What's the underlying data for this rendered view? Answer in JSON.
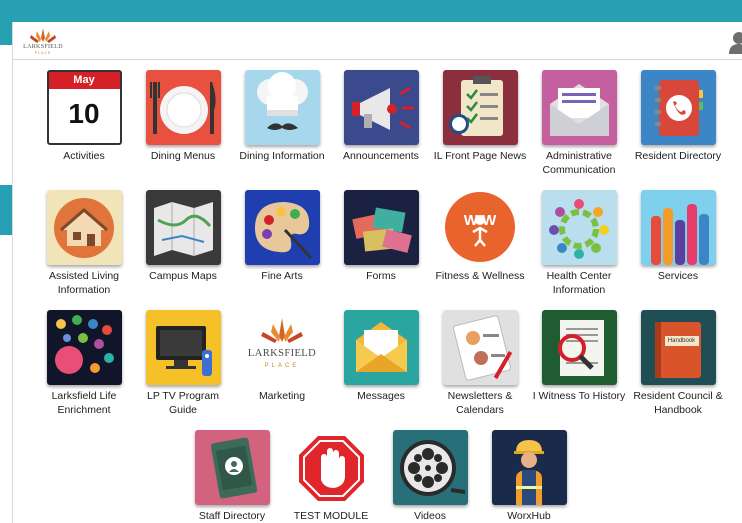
{
  "header": {
    "logo_text": "LARKSFIELD",
    "logo_sub": "PLACE"
  },
  "calendar": {
    "month": "May",
    "day": "10"
  },
  "marketing_logo": {
    "text": "LARKSFIELD",
    "sub": "PLACE"
  },
  "sticky_note": "Handbook",
  "tiles": [
    {
      "label": "Activities"
    },
    {
      "label": "Dining Menus"
    },
    {
      "label": "Dining Information"
    },
    {
      "label": "Announcements"
    },
    {
      "label": "IL Front Page News"
    },
    {
      "label": "Administrative Communication"
    },
    {
      "label": "Resident Directory"
    },
    {
      "label": "Assisted Living Information"
    },
    {
      "label": "Campus Maps"
    },
    {
      "label": "Fine Arts"
    },
    {
      "label": "Forms"
    },
    {
      "label": "Fitness & Wellness"
    },
    {
      "label": "Health Center Information"
    },
    {
      "label": "Services"
    },
    {
      "label": "Larksfield Life Enrichment"
    },
    {
      "label": "LP TV Program Guide"
    },
    {
      "label": "Marketing"
    },
    {
      "label": "Messages"
    },
    {
      "label": "Newsletters & Calendars"
    },
    {
      "label": "I Witness To History"
    },
    {
      "label": "Resident Council & Handbook"
    },
    {
      "label": "Staff Directory"
    },
    {
      "label": "TEST MODULE"
    },
    {
      "label": "Videos"
    },
    {
      "label": "WorxHub"
    }
  ],
  "colors": {
    "frame_teal": "#27a0b3",
    "brand_orange": "#e36d2b"
  }
}
